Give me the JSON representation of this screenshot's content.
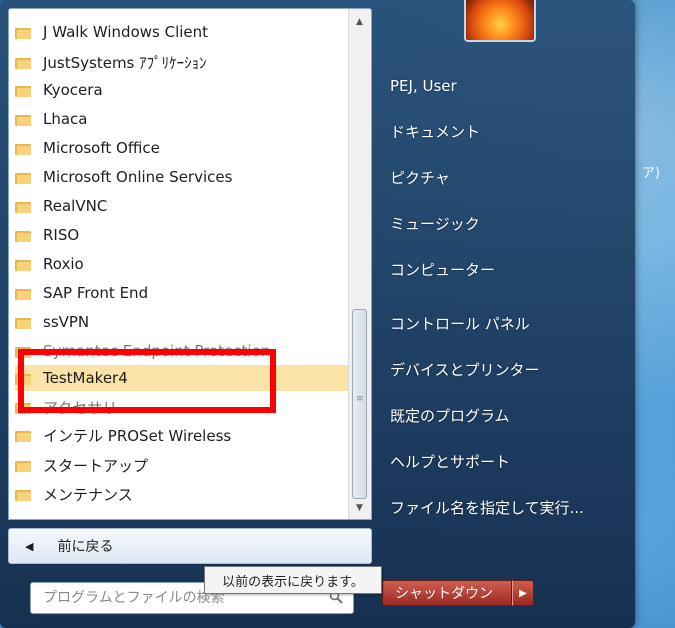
{
  "program_list": {
    "items": [
      {
        "label": "J Walk Windows Client"
      },
      {
        "label": "JustSystems ｱﾌﾟﾘｹｰｼｮﾝ"
      },
      {
        "label": "Kyocera"
      },
      {
        "label": "Lhaca"
      },
      {
        "label": "Microsoft Office"
      },
      {
        "label": "Microsoft Online Services"
      },
      {
        "label": "RealVNC"
      },
      {
        "label": "RISO"
      },
      {
        "label": "Roxio"
      },
      {
        "label": "SAP Front End"
      },
      {
        "label": "ssVPN"
      },
      {
        "label": "Symantec Endpoint Protection"
      },
      {
        "label": "TestMaker4"
      },
      {
        "label": "アクセサリ"
      },
      {
        "label": "インテル PROSet Wireless"
      },
      {
        "label": "スタートアップ"
      },
      {
        "label": "メンテナンス"
      }
    ],
    "selected": "TestMaker4"
  },
  "back_button": {
    "label": "前に戻る"
  },
  "search": {
    "placeholder": "プログラムとファイルの検索"
  },
  "tooltip": {
    "text": "以前の表示に戻ります。"
  },
  "right_panel": {
    "links": [
      {
        "label": "PEJ, User"
      },
      {
        "label": "ドキュメント"
      },
      {
        "label": "ピクチャ"
      },
      {
        "label": "ミュージック"
      },
      {
        "label": "コンピューター"
      },
      {
        "label": "コントロール パネル"
      },
      {
        "label": "デバイスとプリンター"
      },
      {
        "label": "既定のプログラム"
      },
      {
        "label": "ヘルプとサポート"
      },
      {
        "label": "ファイル名を指定して実行..."
      }
    ],
    "shutdown_label": "シャットダウン"
  },
  "colors": {
    "highlight": "#ff0000",
    "selected_row": "#fbe3a8",
    "folder": "#f7d27a"
  }
}
